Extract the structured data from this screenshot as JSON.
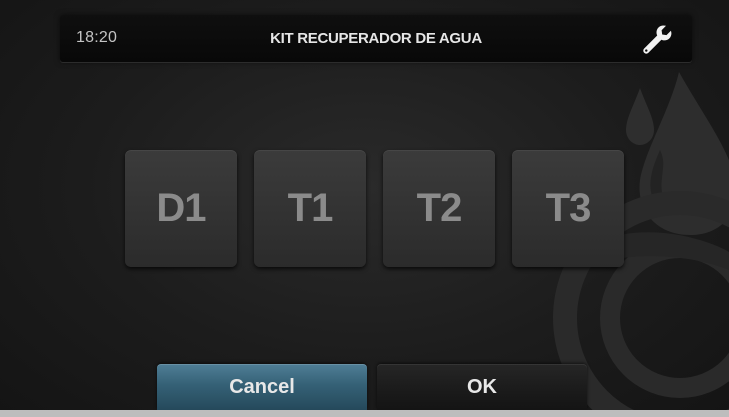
{
  "header": {
    "time": "18:20",
    "title": "KIT RECUPERADOR DE AGUA",
    "settings_icon": "wrench-icon"
  },
  "sensor_buttons": [
    {
      "label": "D1"
    },
    {
      "label": "T1"
    },
    {
      "label": "T2"
    },
    {
      "label": "T3"
    }
  ],
  "footer": {
    "cancel_label": "Cancel",
    "ok_label": "OK"
  },
  "background_icon": "water-drop-logo",
  "colors": {
    "background": "#1c1c1c",
    "header": "#0b0b0b",
    "sensor_button": "#353535",
    "sensor_text": "#8b8b8b",
    "cancel_accent": "#356176",
    "ok_button": "#1c1c1c",
    "text": "#e6e6e6"
  }
}
